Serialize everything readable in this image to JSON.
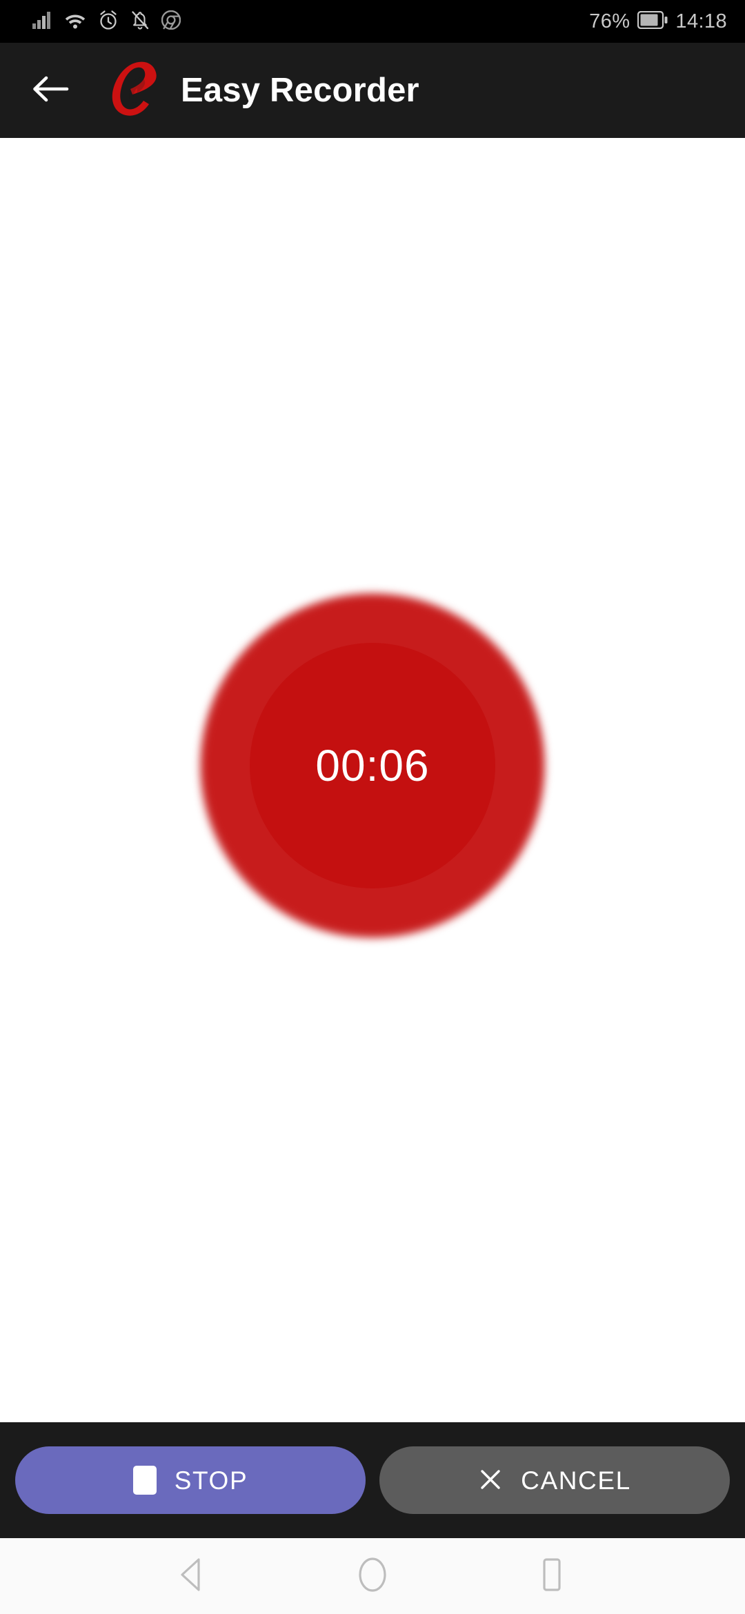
{
  "status_bar": {
    "background": "#000000",
    "text_color": "#c9c9c9",
    "battery_percent": "76%",
    "time": "14:18",
    "left_icons": [
      {
        "name": "signal-bars-icon",
        "label": "cellular signal"
      },
      {
        "name": "wifi-icon",
        "label": "wifi connected"
      },
      {
        "name": "alarm-clock-icon",
        "label": "alarm set"
      },
      {
        "name": "notifications-muted-icon",
        "label": "ringer silenced"
      },
      {
        "name": "chrome-icon",
        "label": "chrome notification"
      }
    ],
    "right_icons": [
      {
        "name": "battery-icon",
        "label": "battery 76 percent"
      }
    ]
  },
  "app_bar": {
    "background": "#1b1b1b",
    "title": "Easy Recorder",
    "back_icon": "back-arrow-icon",
    "logo_icon": "easy-recorder-logo-icon",
    "logo_color": "#cc1111",
    "title_color": "#ffffff"
  },
  "recorder": {
    "background": "#ffffff",
    "timer": "00:06",
    "circle_color": "#c41010",
    "glow_color": "#e15a5a",
    "timer_color": "#ffffff",
    "state": "recording"
  },
  "action_bar": {
    "background": "#1b1b1b",
    "buttons": [
      {
        "id": "stop",
        "label": "STOP",
        "icon": "stop-square-icon",
        "background": "#6a6abd",
        "text_color": "#ffffff"
      },
      {
        "id": "cancel",
        "label": "CANCEL",
        "icon": "close-x-icon",
        "background": "#5c5c5c",
        "text_color": "#ffffff"
      }
    ]
  },
  "nav_bar": {
    "background": "#fafafa",
    "icon_color": "#bdbdbd",
    "buttons": [
      {
        "name": "nav-back-icon",
        "label": "Back"
      },
      {
        "name": "nav-home-icon",
        "label": "Home"
      },
      {
        "name": "nav-recents-icon",
        "label": "Recents"
      }
    ]
  }
}
